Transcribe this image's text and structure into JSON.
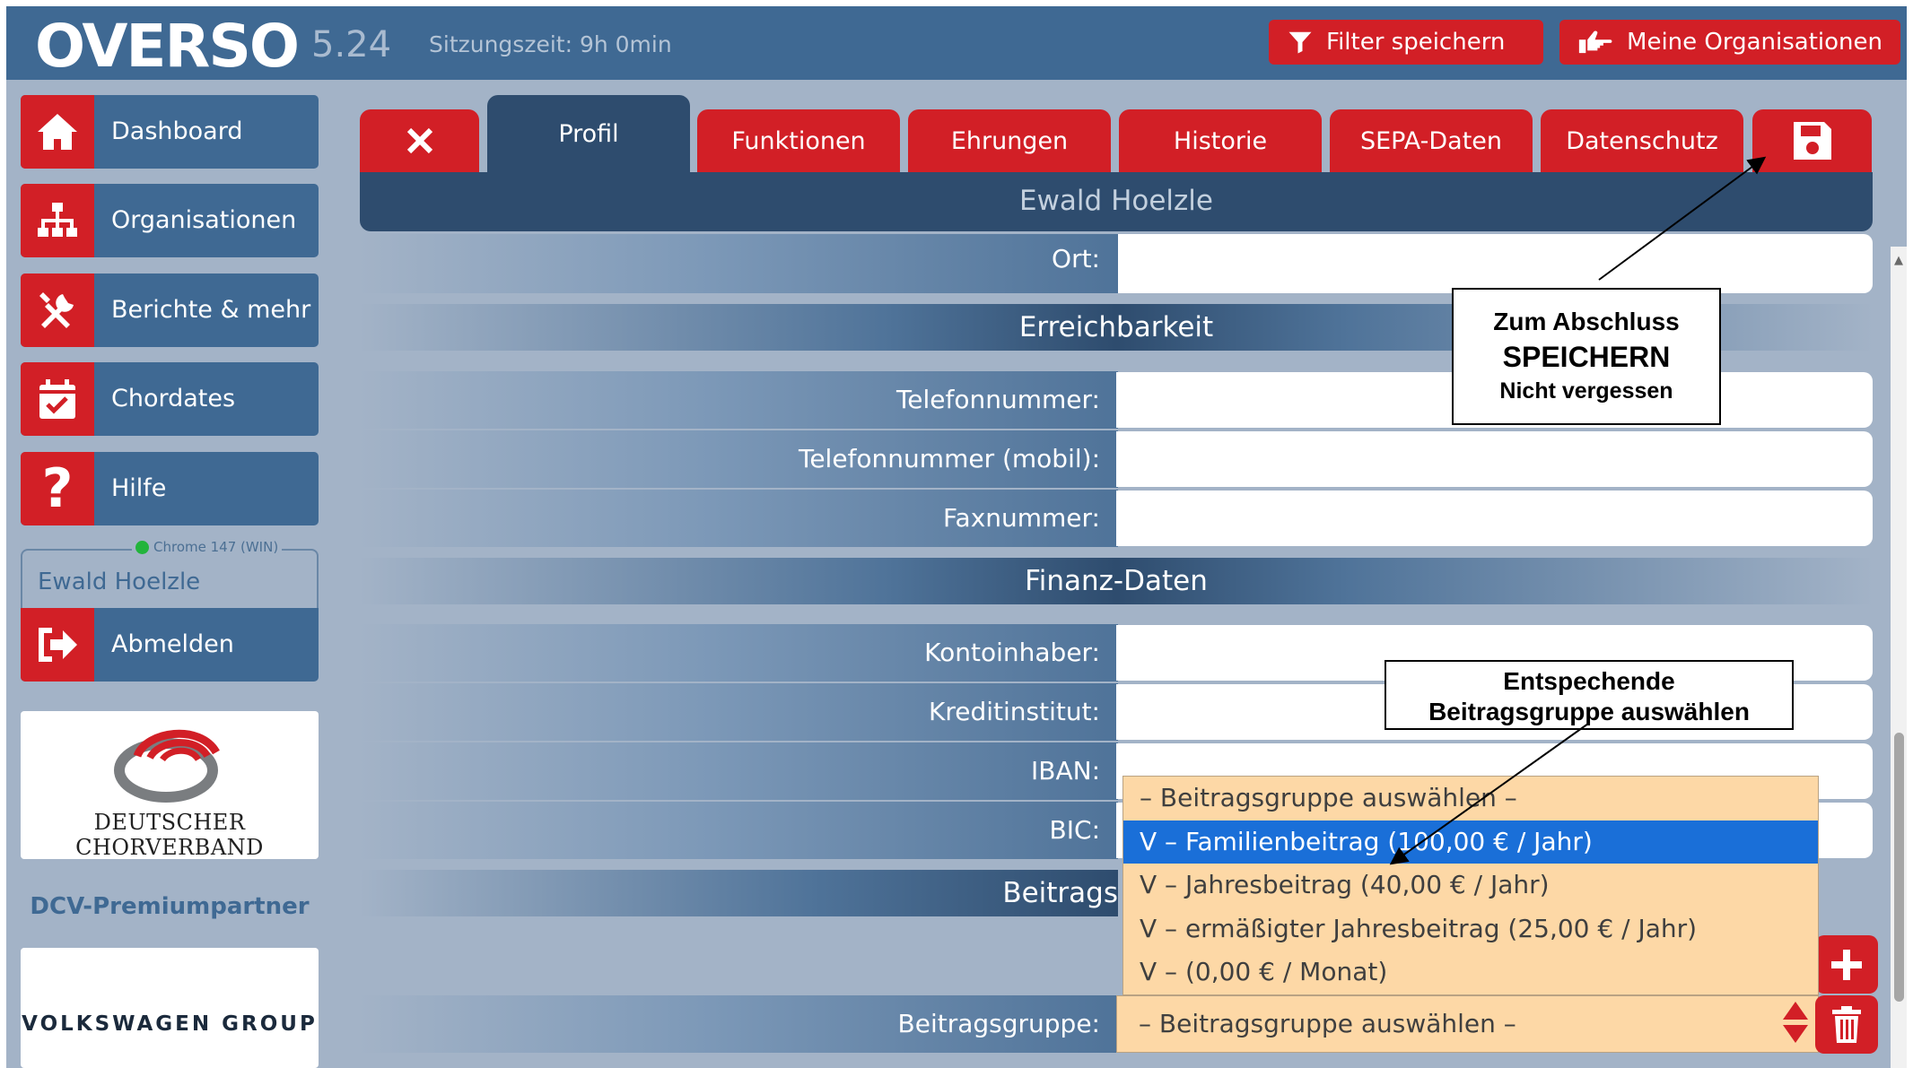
{
  "app": {
    "brand": "OVERSO",
    "version": "5.24",
    "session": "Sitzungszeit: 9h 0min",
    "filter_button": "Filter speichern",
    "org_button": "Meine Organisationen"
  },
  "sidebar": {
    "items": [
      {
        "label": "Dashboard",
        "icon": "home-icon"
      },
      {
        "label": "Organisationen",
        "icon": "org-chart-icon"
      },
      {
        "label": "Berichte & mehr",
        "icon": "tools-icon"
      },
      {
        "label": "Chordates",
        "icon": "calendar-check-icon"
      },
      {
        "label": "Hilfe",
        "icon": "question-icon"
      }
    ],
    "browser_info": "Chrome 147 (WIN)",
    "user_name": "Ewald Hoelzle",
    "logout": "Abmelden",
    "dcv_logo_text": "Deutscher Chorverband",
    "partner_label": "DCV-Premiumpartner",
    "vw_logo_text": "VOLKSWAGEN GROUP"
  },
  "tabs": {
    "profil": "Profil",
    "funktionen": "Funktionen",
    "ehrungen": "Ehrungen",
    "historie": "Historie",
    "sepa": "SEPA-Daten",
    "datenschutz": "Datenschutz",
    "active": "Profil"
  },
  "person_name": "Ewald Hoelzle",
  "form": {
    "ort_label": "Ort:",
    "section_reach": "Erreichbarkeit",
    "telefon_label": "Telefonnummer:",
    "mobil_label": "Telefonnummer (mobil):",
    "fax_label": "Faxnummer:",
    "section_finance": "Finanz-Daten",
    "kontoinhaber_label": "Kontoinhaber:",
    "kreditinstitut_label": "Kreditinstitut:",
    "iban_label": "IBAN:",
    "bic_label": "BIC:",
    "section_beitrag_partial": "Beitrags",
    "beitragsgruppe_label": "Beitragsgruppe:",
    "beitragsgruppe_value": "– Beitragsgruppe auswählen –"
  },
  "dropdown": {
    "options": [
      "– Beitragsgruppe auswählen –",
      "V – Familienbeitrag (100,00 € / Jahr)",
      "V – Jahresbeitrag (40,00 € / Jahr)",
      "V – ermäßigter Jahresbeitrag (25,00 € / Jahr)",
      "V – (0,00 € / Monat)"
    ],
    "selected": "V – Familienbeitrag (100,00 € / Jahr)"
  },
  "annotations": {
    "save_l1": "Zum Abschluss",
    "save_l2": "SPEICHERN",
    "save_l3": "Nicht vergessen",
    "group_l1": "Entspechende",
    "group_l2": "Beitragsgruppe auswählen"
  },
  "colors": {
    "brand_blue": "#3f6993",
    "dark_navy": "#2e4c6e",
    "accent_red": "#d21f26",
    "background": "#a3b3c7",
    "select_peach": "#fdd8a6",
    "selected_option": "#1a6fd8"
  }
}
